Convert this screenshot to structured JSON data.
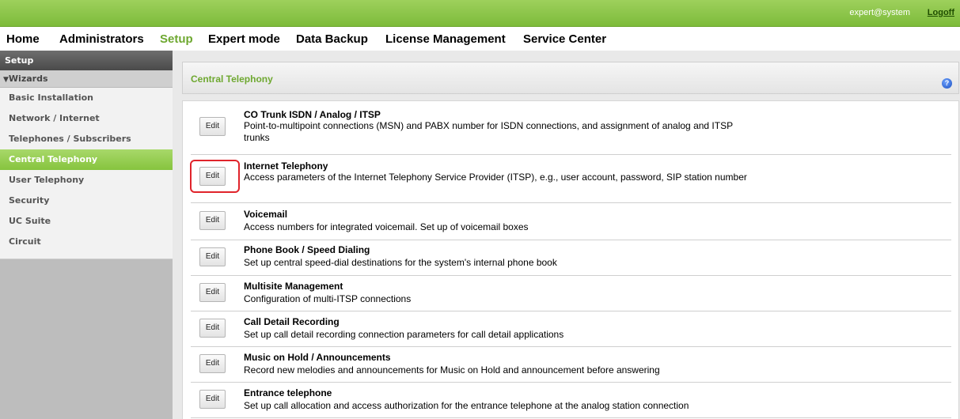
{
  "header": {
    "user": "expert@system",
    "logoff": "Logoff"
  },
  "nav": {
    "items": [
      {
        "label": "Home"
      },
      {
        "label": "Administrators"
      },
      {
        "label": "Setup",
        "active": true
      },
      {
        "label": "Expert mode"
      },
      {
        "label": "Data Backup"
      },
      {
        "label": "License Management"
      },
      {
        "label": "Service Center"
      }
    ]
  },
  "sidebar": {
    "title": "Setup",
    "group": "Wizards",
    "items": [
      {
        "label": "Basic Installation"
      },
      {
        "label": "Network / Internet"
      },
      {
        "label": "Telephones / Subscribers"
      },
      {
        "label": "Central Telephony",
        "active": true
      },
      {
        "label": "User Telephony"
      },
      {
        "label": "Security"
      },
      {
        "label": "UC Suite"
      },
      {
        "label": "Circuit"
      }
    ]
  },
  "panel": {
    "title": "Central Telephony",
    "help": "?"
  },
  "wizards": [
    {
      "name": "CO Trunk ISDN / Analog / ITSP",
      "desc": "Point-to-multipoint connections (MSN) and PABX number for ISDN connections, and assignment of analog and ITSP trunks",
      "edit": "Edit"
    },
    {
      "name": "Internet Telephony",
      "desc": "Access parameters of the Internet Telephony Service Provider (ITSP), e.g., user account, password, SIP station number",
      "edit": "Edit",
      "highlighted": true
    },
    {
      "name": "Voicemail",
      "desc": "Access numbers for integrated voicemail. Set up of voicemail boxes",
      "edit": "Edit"
    },
    {
      "name": "Phone Book / Speed Dialing",
      "desc": "Set up central speed-dial destinations for the system's internal phone book",
      "edit": "Edit"
    },
    {
      "name": "Multisite Management",
      "desc": "Configuration of multi-ITSP connections",
      "edit": "Edit"
    },
    {
      "name": "Call Detail Recording",
      "desc": "Set up call detail recording connection parameters for call detail applications",
      "edit": "Edit"
    },
    {
      "name": "Music on Hold / Announcements",
      "desc": "Record new melodies and announcements for Music on Hold and announcement before answering",
      "edit": "Edit"
    },
    {
      "name": "Entrance telephone",
      "desc": "Set up call allocation and access authorization for the entrance telephone at the analog station connection",
      "edit": "Edit"
    }
  ]
}
